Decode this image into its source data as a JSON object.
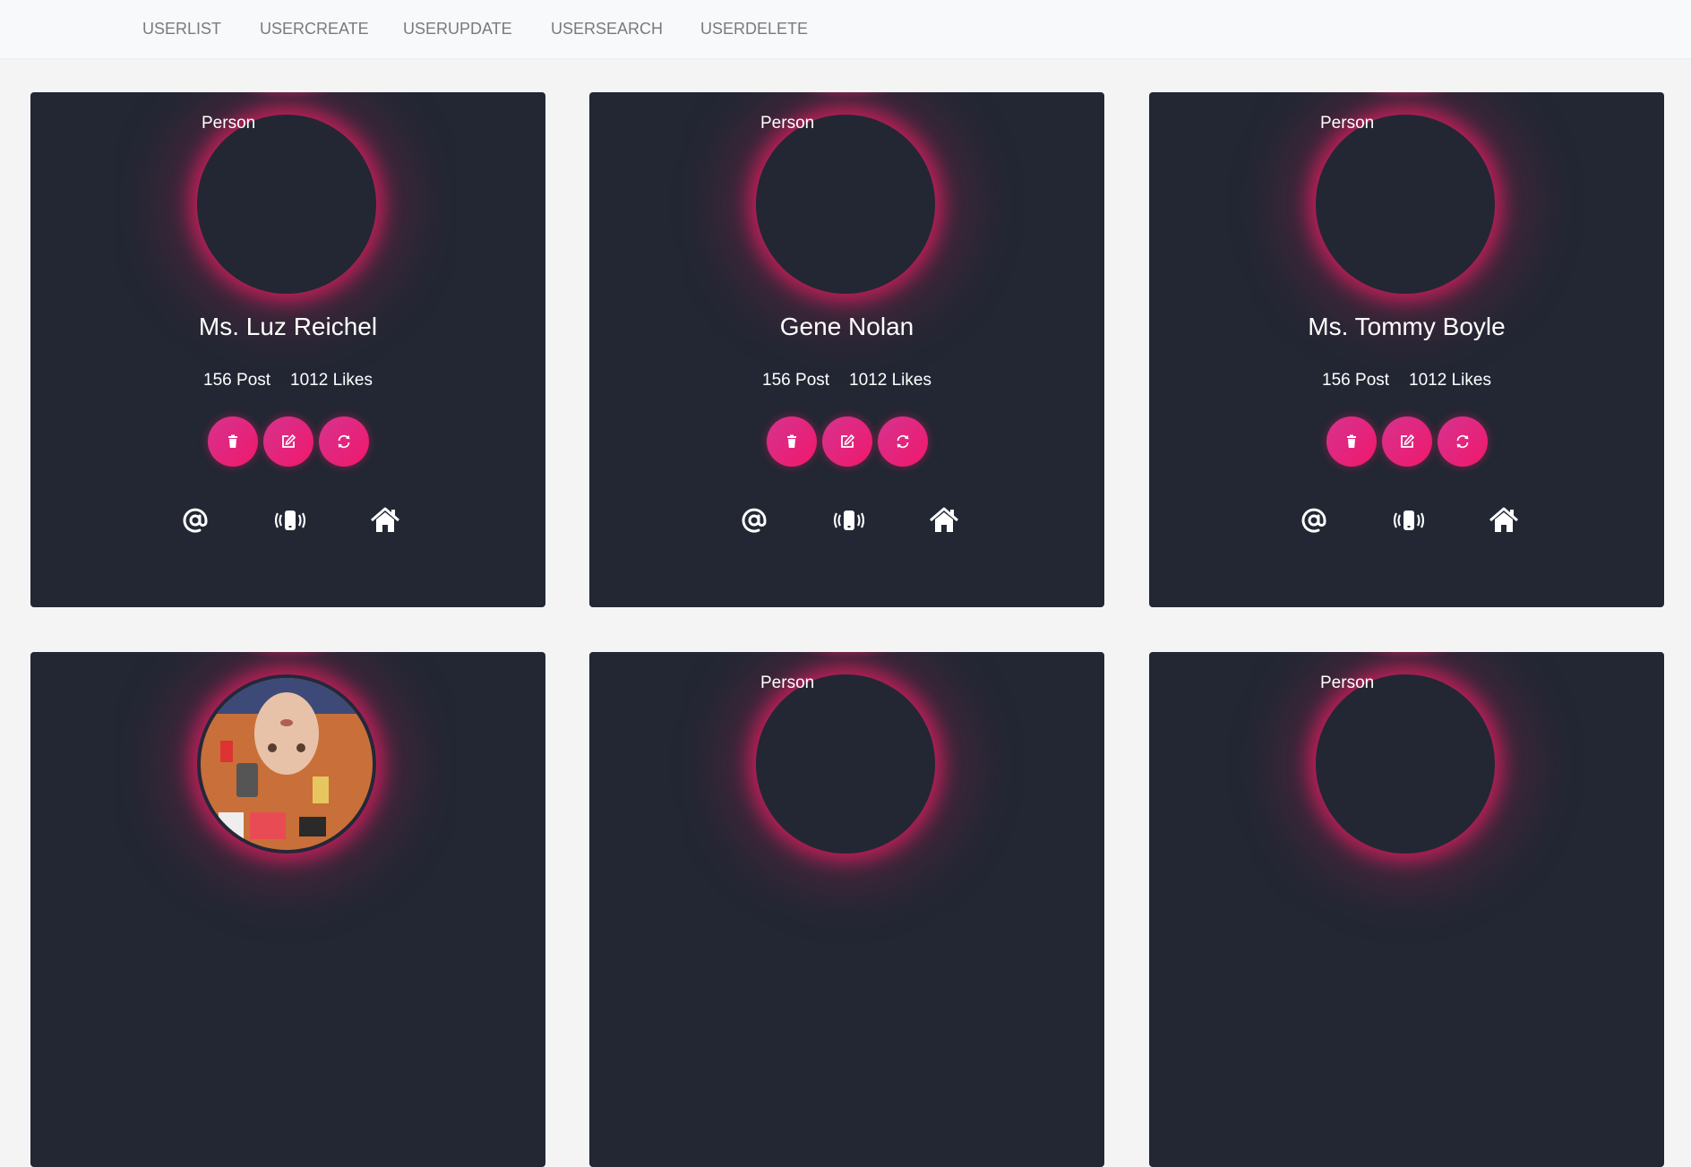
{
  "nav": {
    "items": [
      "USERLIST",
      "USERCREATE",
      "USERUPDATE",
      "USERSEARCH",
      "USERDELETE"
    ]
  },
  "colors": {
    "accent": "#e91e63",
    "card_bg": "#222733",
    "page_bg": "#f4f4f5",
    "navbar_bg": "#f8f9fa"
  },
  "cards": [
    {
      "name": "Ms. Luz Reichel",
      "avatar_alt": "Person",
      "posts": "156 Post",
      "likes": "1012 Likes",
      "photo": false
    },
    {
      "name": "Gene Nolan",
      "avatar_alt": "Person",
      "posts": "156 Post",
      "likes": "1012 Likes",
      "photo": false
    },
    {
      "name": "Ms. Tommy Boyle",
      "avatar_alt": "Person",
      "posts": "156 Post",
      "likes": "1012 Likes",
      "photo": false
    },
    {
      "name": "",
      "avatar_alt": "",
      "posts": "",
      "likes": "",
      "photo": true
    },
    {
      "name": "",
      "avatar_alt": "Person",
      "posts": "",
      "likes": "",
      "photo": false
    },
    {
      "name": "",
      "avatar_alt": "Person",
      "posts": "",
      "likes": "",
      "photo": false
    }
  ],
  "icons": {
    "actions": [
      "trash-icon",
      "edit-icon",
      "refresh-icon"
    ],
    "contacts": [
      "at-sign-icon",
      "phone-vibrate-icon",
      "home-icon"
    ]
  }
}
